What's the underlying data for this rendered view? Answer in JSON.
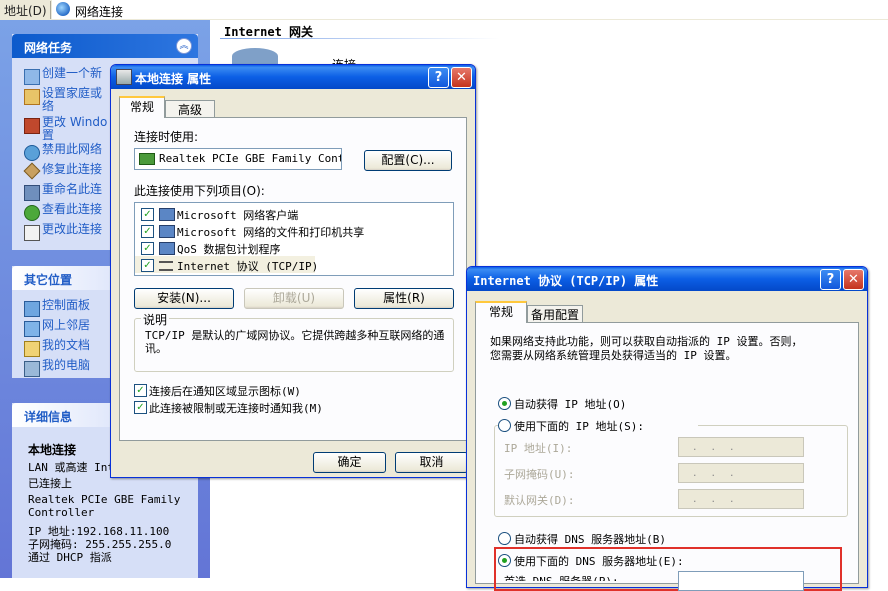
{
  "address_bar": {
    "label": "地址(D)",
    "location": "网络连接"
  },
  "left_pane": {
    "network_tasks": {
      "title": "网络任务",
      "items": [
        {
          "label": "创建一个新",
          "icon": "new-connection-icon"
        },
        {
          "label": "设置家庭或\n络",
          "icon": "home-network-icon"
        },
        {
          "label": "更改 Windo\n置",
          "icon": "firewall-icon"
        },
        {
          "label": "禁用此网络",
          "icon": "disable-network-icon"
        },
        {
          "label": "修复此连接",
          "icon": "repair-icon"
        },
        {
          "label": "重命名此连",
          "icon": "rename-icon"
        },
        {
          "label": "查看此连接",
          "icon": "status-icon"
        },
        {
          "label": "更改此连接",
          "icon": "properties-icon"
        }
      ]
    },
    "other_places": {
      "title": "其它位置",
      "items": [
        {
          "label": "控制面板",
          "icon": "control-panel-icon"
        },
        {
          "label": "网上邻居",
          "icon": "network-places-icon"
        },
        {
          "label": "我的文档",
          "icon": "my-documents-icon"
        },
        {
          "label": "我的电脑",
          "icon": "my-computer-icon"
        }
      ]
    },
    "details": {
      "title": "详细信息",
      "name": "本地连接",
      "type": "LAN 或高速 Int",
      "status": "已连接上",
      "adapter_line1": "Realtek PCIe GBE Family",
      "adapter_line2": "Controller",
      "ip": "IP 地址:192.168.11.100",
      "mask": "子网掩码: 255.255.255.0",
      "dhcp": "通过 DHCP 指派"
    }
  },
  "content": {
    "header": "Internet 网关",
    "partial_text": "连接"
  },
  "local_conn_dialog": {
    "title": "本地连接 属性",
    "tabs": [
      "常规",
      "高级"
    ],
    "connect_using_label": "连接时使用:",
    "adapter": "Realtek PCIe GBE Family Contro",
    "configure_button": "配置(C)...",
    "items_label": "此连接使用下列项目(O):",
    "items": [
      {
        "label": "Microsoft 网络客户端",
        "checked": true
      },
      {
        "label": "Microsoft 网络的文件和打印机共享",
        "checked": true
      },
      {
        "label": "QoS 数据包计划程序",
        "checked": true
      },
      {
        "label": "Internet 协议 (TCP/IP)",
        "checked": true
      }
    ],
    "install_button": "安装(N)...",
    "uninstall_button": "卸载(U)",
    "properties_button": "属性(R)",
    "description_title": "说明",
    "description": "TCP/IP 是默认的广域网协议。它提供跨越多种互联网络的通讯。",
    "show_icon_label": "连接后在通知区域显示图标(W)",
    "notify_label": "此连接被限制或无连接时通知我(M)",
    "ok_button": "确定",
    "cancel_button": "取消"
  },
  "tcpip_dialog": {
    "title": "Internet 协议 (TCP/IP) 属性",
    "tabs": [
      "常规",
      "备用配置"
    ],
    "intro_line1": "如果网络支持此功能，则可以获取自动指派的 IP 设置。否则，",
    "intro_line2": "您需要从网络系统管理员处获得适当的 IP 设置。",
    "auto_ip": "自动获得 IP 地址(O)",
    "manual_ip": "使用下面的 IP 地址(S):",
    "ip_address_label": "IP 地址(I):",
    "subnet_label": "子网掩码(U):",
    "gateway_label": "默认网关(D):",
    "auto_dns": "自动获得 DNS 服务器地址(B)",
    "manual_dns": "使用下面的 DNS 服务器地址(E):",
    "preferred_dns_label": "首选 DNS 服务器(P):",
    "ip_placeholder": "...",
    "highlight_color": "#e0312a"
  }
}
